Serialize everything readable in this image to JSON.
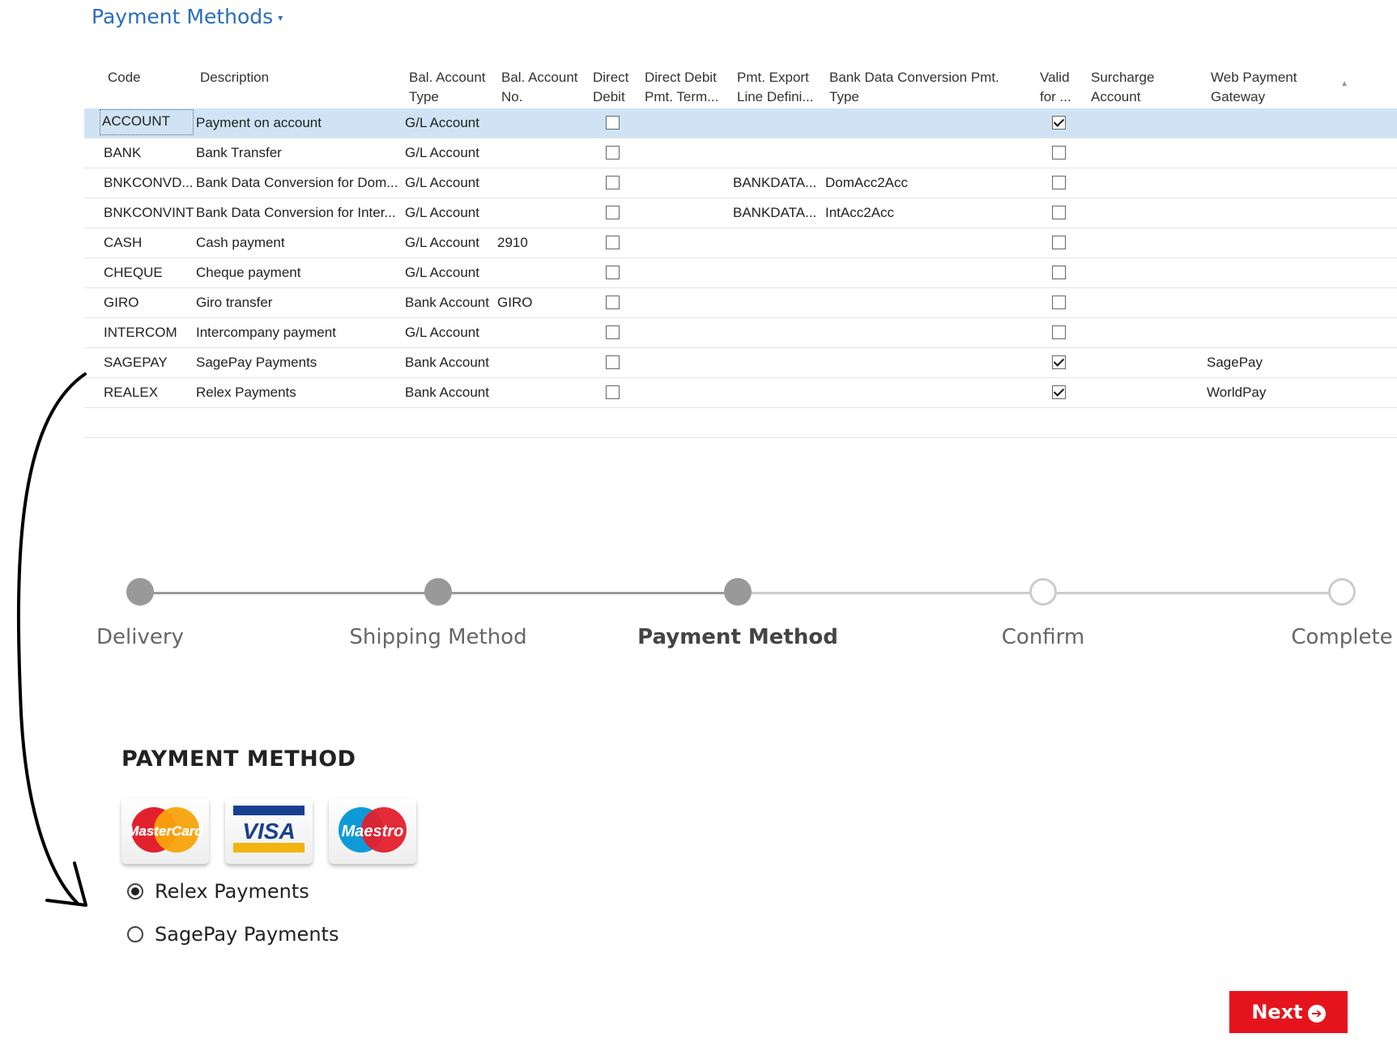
{
  "page": {
    "title": "Payment Methods"
  },
  "table": {
    "columns": [
      {
        "key": "code",
        "label": "Code"
      },
      {
        "key": "description",
        "label": "Description"
      },
      {
        "key": "bal_type",
        "label": "Bal. Account Type"
      },
      {
        "key": "bal_no",
        "label": "Bal. Account No."
      },
      {
        "key": "direct_debit",
        "label": "Direct Debit"
      },
      {
        "key": "dd_term",
        "label": "Direct Debit Pmt. Term..."
      },
      {
        "key": "pmt_export",
        "label": "Pmt. Export Line Defini..."
      },
      {
        "key": "bank_conv",
        "label": "Bank Data Conversion Pmt. Type"
      },
      {
        "key": "valid_for",
        "label": "Valid for ..."
      },
      {
        "key": "surcharge",
        "label": "Surcharge Account"
      },
      {
        "key": "gateway",
        "label": "Web Payment Gateway"
      }
    ],
    "header_lines": {
      "code": [
        "Code"
      ],
      "description": [
        "Description"
      ],
      "bal_type": [
        "Bal. Account",
        "Type"
      ],
      "bal_no": [
        "Bal. Account",
        "No."
      ],
      "direct_debit": [
        "Direct",
        "Debit"
      ],
      "dd_term": [
        "Direct Debit",
        "Pmt. Term..."
      ],
      "pmt_export": [
        "Pmt. Export",
        "Line Defini..."
      ],
      "bank_conv": [
        "Bank Data Conversion Pmt.",
        "Type"
      ],
      "valid_for": [
        "Valid",
        "for ..."
      ],
      "surcharge": [
        "Surcharge",
        "Account"
      ],
      "gateway": [
        "Web Payment",
        "Gateway"
      ]
    },
    "rows": [
      {
        "code": "ACCOUNT",
        "description": "Payment on account",
        "bal_type": "G/L Account",
        "bal_no": "",
        "direct_debit": false,
        "pmt_export": "",
        "bank_conv": "",
        "valid_for": true,
        "gateway": "",
        "selected": true
      },
      {
        "code": "BANK",
        "description": "Bank Transfer",
        "bal_type": "G/L Account",
        "bal_no": "",
        "direct_debit": false,
        "pmt_export": "",
        "bank_conv": "",
        "valid_for": false,
        "gateway": ""
      },
      {
        "code": "BNKCONVD...",
        "description": "Bank Data Conversion for Dom...",
        "bal_type": "G/L Account",
        "bal_no": "",
        "direct_debit": false,
        "pmt_export": "BANKDATA...",
        "bank_conv": "DomAcc2Acc",
        "valid_for": false,
        "gateway": ""
      },
      {
        "code": "BNKCONVINT",
        "description": "Bank Data Conversion for Inter...",
        "bal_type": "G/L Account",
        "bal_no": "",
        "direct_debit": false,
        "pmt_export": "BANKDATA...",
        "bank_conv": "IntAcc2Acc",
        "valid_for": false,
        "gateway": ""
      },
      {
        "code": "CASH",
        "description": "Cash payment",
        "bal_type": "G/L Account",
        "bal_no": "2910",
        "direct_debit": false,
        "pmt_export": "",
        "bank_conv": "",
        "valid_for": false,
        "gateway": ""
      },
      {
        "code": "CHEQUE",
        "description": "Cheque payment",
        "bal_type": "G/L Account",
        "bal_no": "",
        "direct_debit": false,
        "pmt_export": "",
        "bank_conv": "",
        "valid_for": false,
        "gateway": ""
      },
      {
        "code": "GIRO",
        "description": "Giro transfer",
        "bal_type": "Bank Account",
        "bal_no": "GIRO",
        "direct_debit": false,
        "pmt_export": "",
        "bank_conv": "",
        "valid_for": false,
        "gateway": ""
      },
      {
        "code": "INTERCOM",
        "description": "Intercompany payment",
        "bal_type": "G/L Account",
        "bal_no": "",
        "direct_debit": false,
        "pmt_export": "",
        "bank_conv": "",
        "valid_for": false,
        "gateway": ""
      },
      {
        "code": "SAGEPAY",
        "description": "SagePay Payments",
        "bal_type": "Bank Account",
        "bal_no": "",
        "direct_debit": false,
        "pmt_export": "",
        "bank_conv": "",
        "valid_for": true,
        "gateway": "SagePay"
      },
      {
        "code": "REALEX",
        "description": "Relex Payments",
        "bal_type": "Bank Account",
        "bal_no": "",
        "direct_debit": false,
        "pmt_export": "",
        "bank_conv": "",
        "valid_for": true,
        "gateway": "WorldPay"
      }
    ]
  },
  "checkout": {
    "steps": [
      {
        "label": "Delivery",
        "state": "done"
      },
      {
        "label": "Shipping Method",
        "state": "done"
      },
      {
        "label": "Payment Method",
        "state": "done",
        "active": true
      },
      {
        "label": "Confirm",
        "state": "todo"
      },
      {
        "label": "Complete",
        "state": "todo"
      }
    ],
    "section_title": "PAYMENT METHOD",
    "cards": [
      "MasterCard",
      "VISA",
      "Maestro"
    ],
    "options": [
      {
        "label": "Relex Payments",
        "selected": true
      },
      {
        "label": "SagePay Payments",
        "selected": false
      }
    ],
    "next_label": "Next"
  },
  "colors": {
    "accent": "#2a6ebb",
    "selection": "#cfe3f5",
    "next": "#e5141c"
  }
}
